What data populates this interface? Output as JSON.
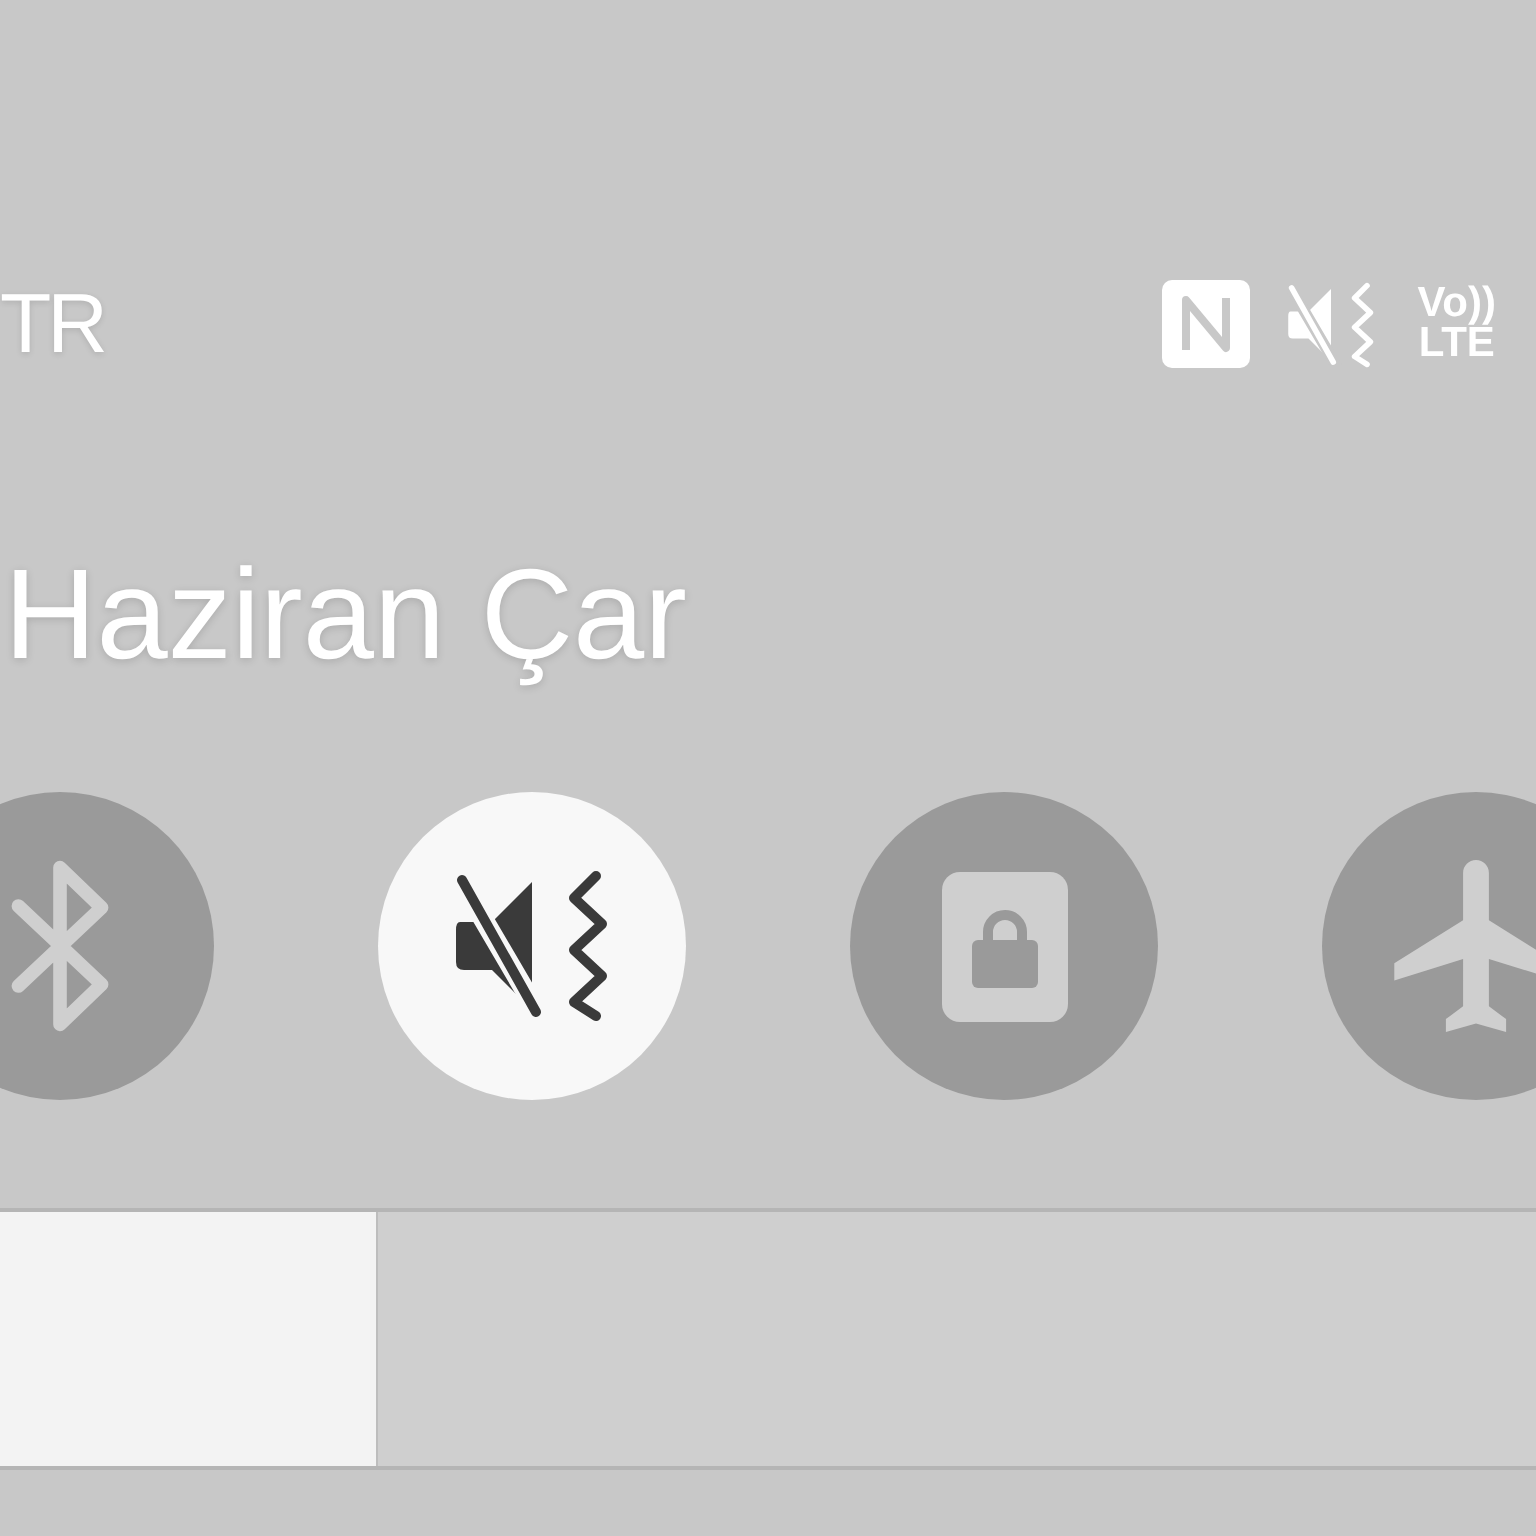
{
  "status_bar": {
    "carrier": "TR",
    "volte": {
      "line_1": "Vo))",
      "line_2": "LTE"
    }
  },
  "date": "Haziran Çar",
  "quick_tiles": [
    {
      "kind": "bluetooth",
      "on": false
    },
    {
      "kind": "sound_mute_vibrate",
      "on": true
    },
    {
      "kind": "screen_lock",
      "on": false
    },
    {
      "kind": "airplane",
      "on": false
    }
  ],
  "brightness": {
    "level": 0.246
  }
}
